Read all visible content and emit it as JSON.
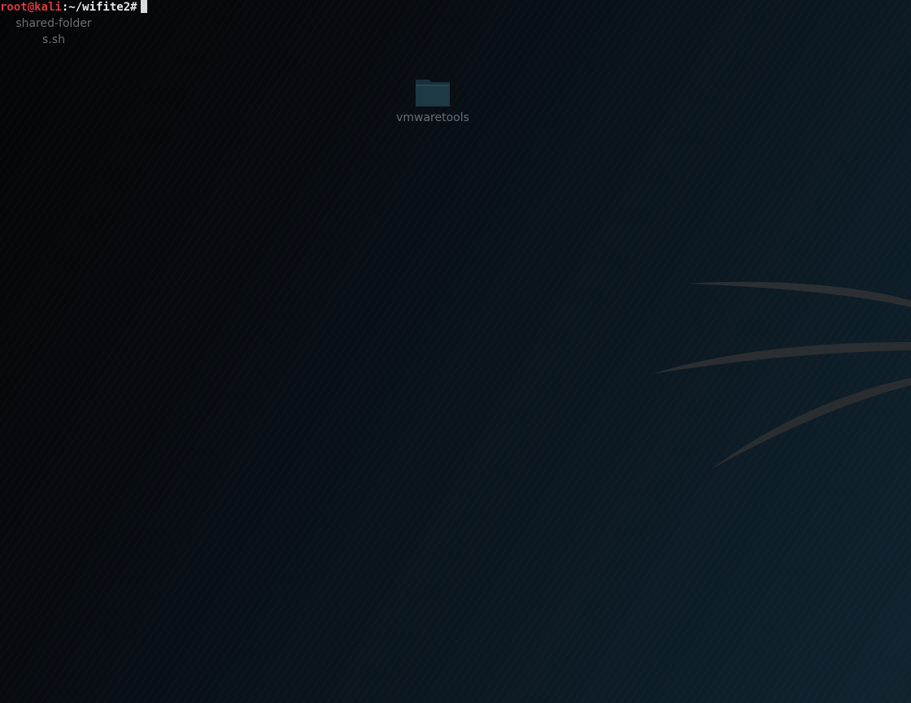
{
  "terminal": {
    "user_host": "root@kali",
    "path": ":~/wifite2",
    "prompt_symbol": "#"
  },
  "desktop": {
    "icons": [
      {
        "label": "shared-folders.sh",
        "icon": "script-file-icon"
      },
      {
        "label": "vmwaretools",
        "icon": "folder-icon"
      }
    ]
  },
  "colors": {
    "prompt_user": "#d53b3b",
    "prompt_text": "#e5e7ea",
    "desktop_dark": "#050608",
    "desktop_teal": "#10242f",
    "icon_text": "#6b6f74",
    "folder_fill": "#18303a"
  }
}
